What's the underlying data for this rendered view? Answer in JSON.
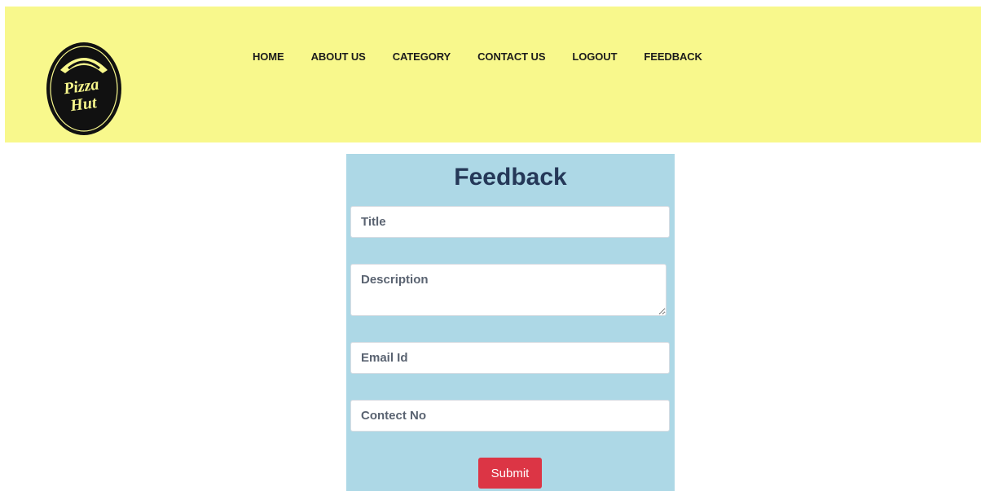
{
  "header": {
    "logo_text": [
      "Pizza",
      "Hut"
    ],
    "nav": [
      {
        "label": "HOME"
      },
      {
        "label": "ABOUT US"
      },
      {
        "label": "CATEGORY"
      },
      {
        "label": "CONTACT US"
      },
      {
        "label": "LOGOUT"
      },
      {
        "label": "FEEDBACK"
      }
    ]
  },
  "form": {
    "title": "Feedback",
    "title_placeholder": "Title",
    "description_placeholder": "Description",
    "email_placeholder": "Email Id",
    "contact_placeholder": "Contect No",
    "submit_label": "Submit"
  },
  "colors": {
    "header_bg": "#f8f88c",
    "panel_bg": "#add8e6",
    "submit_bg": "#dc3545",
    "title_color": "#253858"
  }
}
